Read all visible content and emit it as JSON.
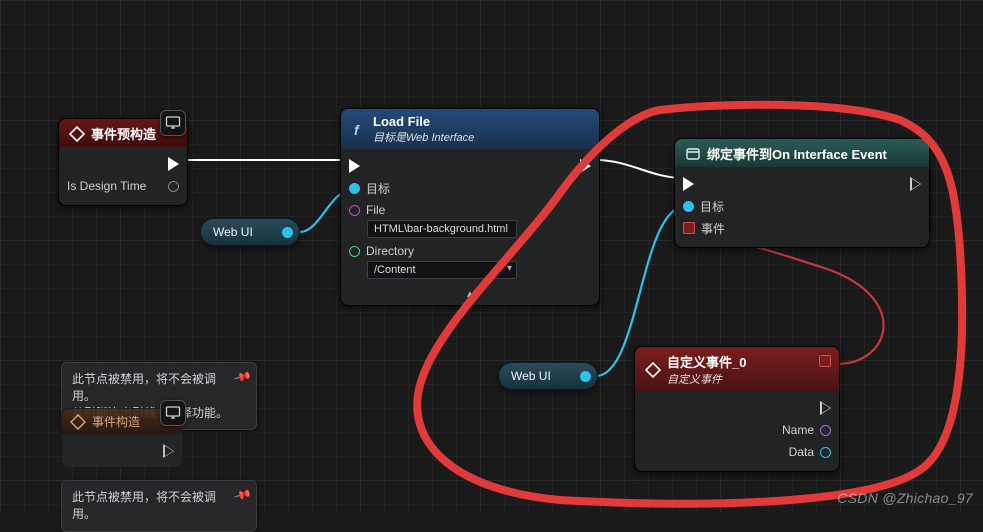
{
  "colors": {
    "exec_wire": "#ffffff",
    "obj_wire": "#2dc3e8",
    "delegate_wire": "#c43a3a",
    "annotation": "#e03a3a"
  },
  "nodes": {
    "preconstruct": {
      "title": "事件预构造",
      "pins": {
        "is_design_time": "Is Design Time"
      }
    },
    "loadfile": {
      "title": "Load File",
      "subtitle": "目标是Web Interface",
      "pins": {
        "target": "目标",
        "file": "File",
        "file_value": "HTML\\bar-background.html",
        "directory": "Directory",
        "directory_value": "/Content"
      }
    },
    "bind": {
      "title": "绑定事件到On Interface Event",
      "pins": {
        "target": "目标",
        "event": "事件"
      }
    },
    "custom": {
      "title": "自定义事件_0",
      "subtitle": "自定义事件",
      "pins": {
        "name": "Name",
        "data": "Data"
      }
    },
    "construct_ghost": {
      "title": "事件构造"
    }
  },
  "pills": {
    "webui1": "Web UI",
    "webui2": "Web UI"
  },
  "notes": {
    "n1_l1": "此节点被禁用，将不会被调用。",
    "n1_l2": "从引脚连出引线来编译功能。",
    "n2_l1": "此节点被禁用，将不会被调用。"
  },
  "watermark": "CSDN @Zhichao_97"
}
